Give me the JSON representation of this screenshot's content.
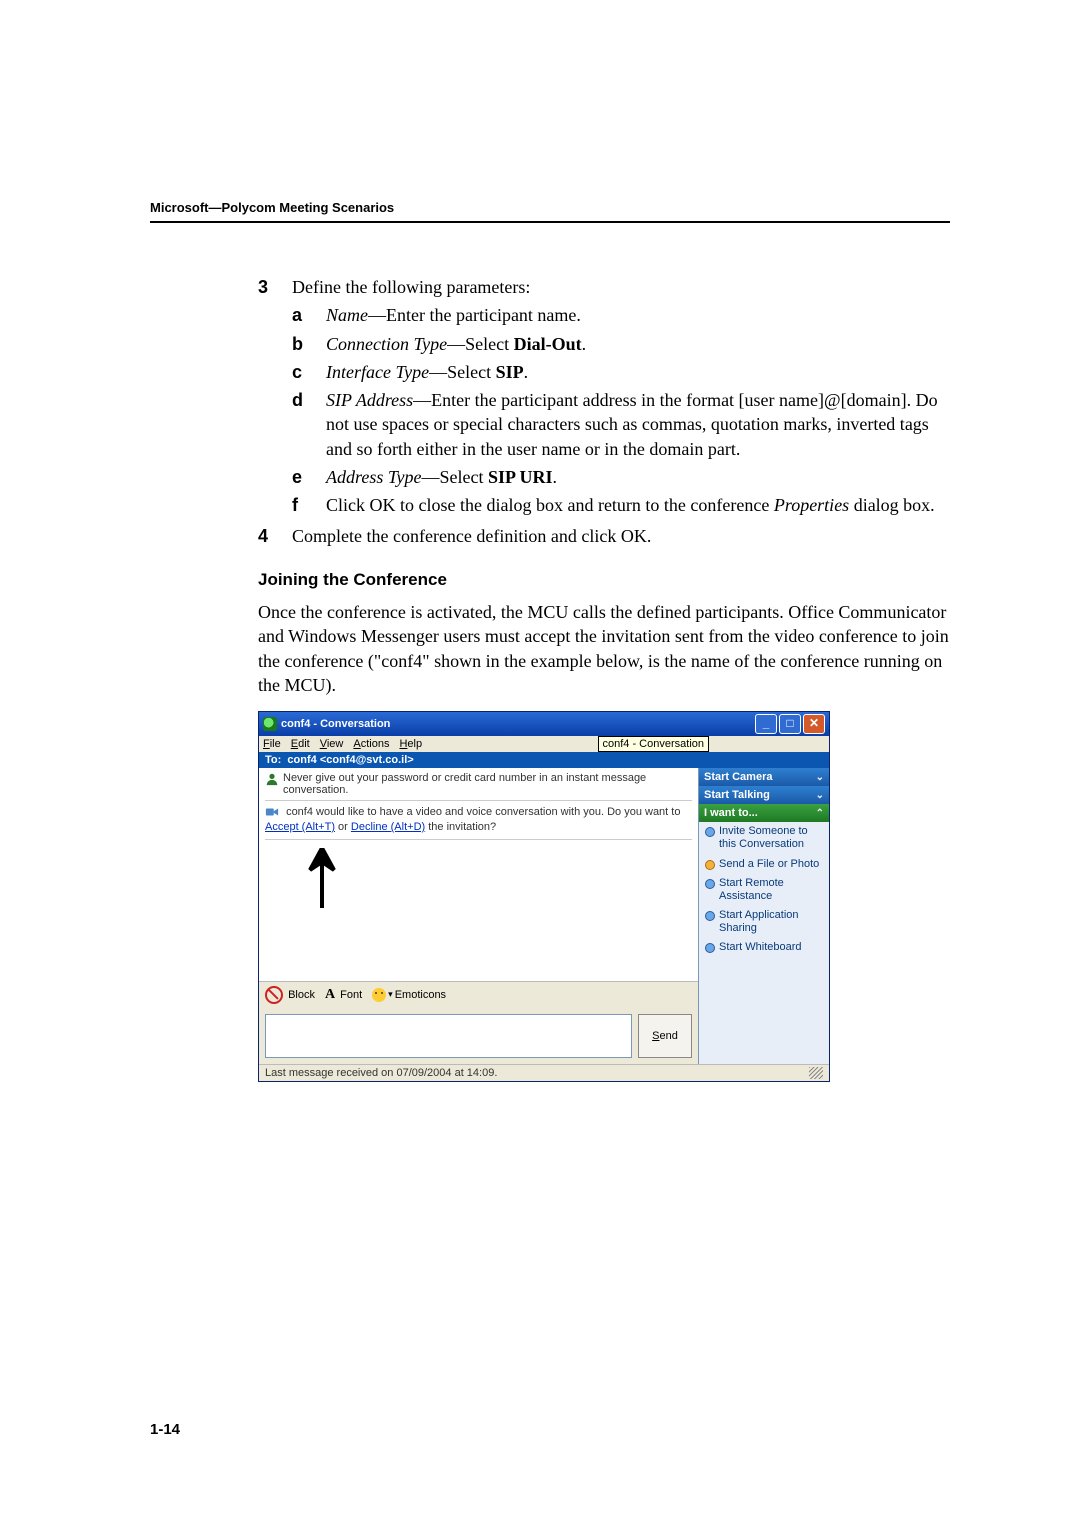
{
  "header": "Microsoft—Polycom Meeting Scenarios",
  "page_no": "1-14",
  "steps": {
    "s3": {
      "marker": "3",
      "text": "Define the following parameters:",
      "subs": {
        "a": {
          "m": "a",
          "label": "Name",
          "rest": "—Enter the participant name."
        },
        "b": {
          "m": "b",
          "label": "Connection Type",
          "rest": "—Select ",
          "bold": "Dial-Out",
          "tail": "."
        },
        "c": {
          "m": "c",
          "label": "Interface Type",
          "rest": "—Select ",
          "bold": "SIP",
          "tail": "."
        },
        "d": {
          "m": "d",
          "label": "SIP Address",
          "rest": "—Enter the participant address in the format [user name]@[domain]. Do not use spaces or special characters such as commas, quotation marks, inverted tags and so forth either in the user name or in the domain part."
        },
        "e": {
          "m": "e",
          "label": "Address Type",
          "rest": "—Select ",
          "bold": "SIP URI",
          "tail": "."
        },
        "f": {
          "m": "f",
          "pre": "Click OK to close the dialog box and return to the conference ",
          "ital": "Properties",
          "post": " dialog box."
        }
      }
    },
    "s4": {
      "marker": "4",
      "text": "Complete the conference definition and click OK."
    }
  },
  "section_title": "Joining the Conference",
  "section_para": "Once the conference is activated, the MCU calls the defined participants. Office Communicator and Windows Messenger users must accept the invitation sent from the video conference to join the conference (\"conf4\" shown in the example below, is the name of the conference running on the MCU).",
  "shot": {
    "title": "conf4 - Conversation",
    "menus": {
      "file": "File",
      "edit": "Edit",
      "view": "View",
      "actions": "Actions",
      "help": "Help"
    },
    "tooltip": "conf4 - Conversation",
    "to_label": "To:",
    "to_value": "conf4 <conf4@svt.co.il>",
    "warning": "Never give out your password or credit card number in an instant message conversation.",
    "invite_pre": "conf4 would like to have a video and voice conversation with you. Do you want to ",
    "accept": "Accept (Alt+T)",
    "or": " or ",
    "decline": "Decline (Alt+D)",
    "invite_post": " the invitation?",
    "toolbar": {
      "block": "Block",
      "font": "Font",
      "emoticons": "Emoticons"
    },
    "send": "Send",
    "side": {
      "camera": "Start Camera",
      "talking": "Start Talking",
      "want": "I want to...",
      "items": {
        "invite": "Invite Someone to this Conversation",
        "sendfile": "Send a File or Photo",
        "remote": "Start Remote Assistance",
        "appshare": "Start Application Sharing",
        "whiteboard": "Start Whiteboard"
      }
    },
    "status": "Last message received on 07/09/2004 at 14:09."
  }
}
